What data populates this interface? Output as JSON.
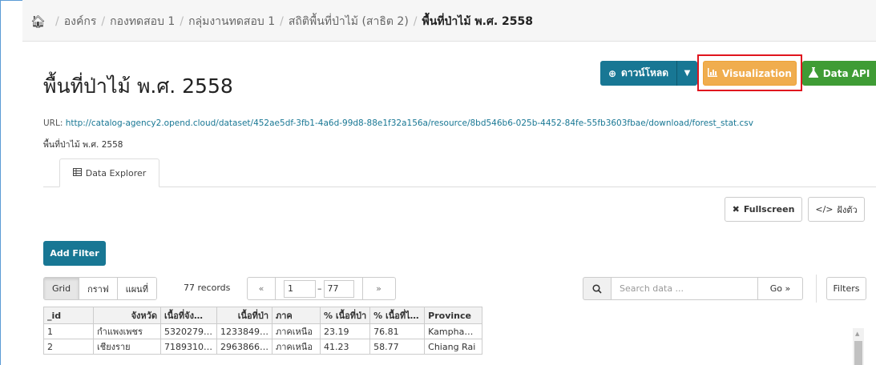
{
  "breadcrumb": {
    "home_icon": "home-icon",
    "items": [
      "องค์กร",
      "กองทดสอบ 1",
      "กลุ่มงานทดสอบ 1",
      "สถิติพื้นที่ป่าไม้ (สาธิต 2)",
      "พื้นที่ป่าไม้ พ.ศ. 2558"
    ]
  },
  "resource": {
    "title": "พื้นที่ป่าไม้ พ.ศ. 2558",
    "url_label": "URL:",
    "url": "http://catalog-agency2.opend.cloud/dataset/452ae5df-3fb1-4a6d-99d8-88e1f32a156a/resource/8bd546b6-025b-4452-84fe-55fb3603fbae/download/forest_stat.csv",
    "description": "พื้นที่ป่าไม้ พ.ศ. 2558"
  },
  "actions": {
    "download_label": "ดาวน์โหลด",
    "visualization_label": "Visualization",
    "data_api_label": "Data API"
  },
  "tabs": [
    {
      "label": "Data Explorer"
    }
  ],
  "explorer": {
    "fullscreen_label": "Fullscreen",
    "embed_label": "ฝังตัว",
    "add_filter_label": "Add Filter",
    "views": [
      "Grid",
      "กราฟ",
      "แผนที่"
    ],
    "records": "77 records",
    "pager": {
      "prev": "«",
      "from": "1",
      "dash": "–",
      "to": "77",
      "next": "»"
    },
    "search_placeholder": "Search data ...",
    "go_label": "Go »",
    "filters_label": "Filters"
  },
  "table": {
    "columns": [
      "_id",
      "จังหวัด",
      "เนื้อที่จัง…",
      "เนื้อที่ป่า",
      "ภาค",
      "% เนื้อที่ป่า",
      "% เนื้อที่ไ…",
      "Province"
    ],
    "rows": [
      [
        "1",
        "กำแพงเพชร",
        "5320279…",
        "1233849…",
        "ภาคเหนือ",
        "23.19",
        "76.81",
        "Kampha…"
      ],
      [
        "2",
        "เชียงราย",
        "7189310…",
        "2963866…",
        "ภาคเหนือ",
        "41.23",
        "58.77",
        "Chiang Rai"
      ]
    ]
  },
  "colors": {
    "primary": "#187794",
    "warning": "#f0ad4e",
    "success": "#3f9c35",
    "highlight": "#e0141e"
  }
}
